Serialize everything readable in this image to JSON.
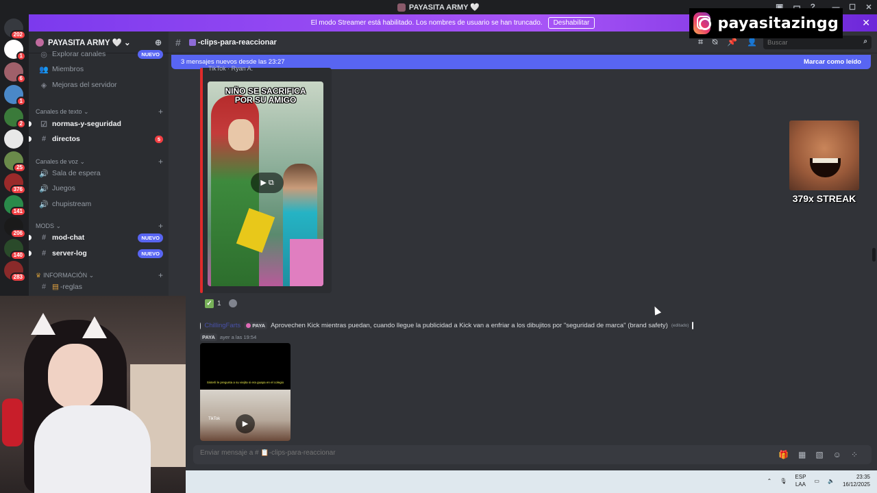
{
  "window": {
    "title": "PAYASITA ARMY 🤍",
    "controls": [
      "—",
      "☐",
      "✕"
    ]
  },
  "banner": {
    "text": "El modo Streamer está habilitado. Los nombres de usuario se han truncado.",
    "button": "Deshabilitar"
  },
  "servers": [
    {
      "badge": "202",
      "color": "#36393f"
    },
    {
      "badge": "1",
      "color": "#ffffff"
    },
    {
      "badge": "6",
      "color": "#a0606a"
    },
    {
      "badge": "1",
      "color": "#4a88c8"
    },
    {
      "badge": "2",
      "color": "#3a7a3a"
    },
    {
      "badge": "",
      "color": "#e8e8e8"
    },
    {
      "badge": "25",
      "color": "#6a8a4a"
    },
    {
      "badge": "376",
      "color": "#9a2a2a"
    },
    {
      "badge": "141",
      "color": "#2a8a4a"
    },
    {
      "badge": "206",
      "color": "#1a1a1a"
    },
    {
      "badge": "140",
      "color": "#2a4a2a"
    },
    {
      "badge": "283",
      "color": "#8a2a2a"
    }
  ],
  "server": {
    "name": "PAYASITA ARMY 🤍 ⌄"
  },
  "sidebar": {
    "top_items": [
      {
        "label": "Explorar canales",
        "badge": "NUEVO"
      },
      {
        "label": "Miembros"
      },
      {
        "label": "Mejoras del servidor"
      }
    ],
    "categories": {
      "text": "Canales de texto ⌄",
      "voice": "Canales de voz ⌄",
      "mods": "MODS ⌄",
      "info": "INFORMACIÓN ⌄"
    },
    "text_channels": [
      {
        "label": "normas-y-seguridad"
      },
      {
        "label": "directos",
        "count": "5"
      }
    ],
    "voice_channels": [
      {
        "label": "Sala de espera"
      },
      {
        "label": "Juegos"
      },
      {
        "label": "chupistream"
      }
    ],
    "mod_channels": [
      {
        "label": "mod-chat",
        "badge": "NUEVO"
      },
      {
        "label": "server-log",
        "badge": "NUEVO"
      }
    ],
    "info_channels": [
      {
        "label": "-reglas"
      }
    ]
  },
  "channel": {
    "name": "-clips-para-reaccionar",
    "search_placeholder": "Buscar"
  },
  "instagram": {
    "handle": "payasitazingg"
  },
  "new_messages": {
    "text": "3 mensajes nuevos desde las 23:27",
    "action": "Marcar como leído"
  },
  "embed1": {
    "author": "TikTok · Ryan A.",
    "caption_line1": "NIÑO SE SACRIFICA",
    "caption_line2": "POR SU AMIGO"
  },
  "reactions": [
    {
      "emoji": "✓",
      "count": "1"
    }
  ],
  "message2": {
    "username": "ChillingFarts",
    "tag": "PAYA",
    "text": "Aprovechen Kick mientras puedan, cuando llegue la publicidad a Kick van a enfriar a los dibujitos por \"seguridad de marca\" (brand safety)",
    "edited": "(editado)",
    "sub_tag": "PAYA",
    "timestamp": "ayer a las 19:54",
    "video_caption": "Sisterli le pregunta a su viejita si era guapa en el colegio",
    "video_source": "TikTok"
  },
  "streak": {
    "label": "379x STREAK"
  },
  "input": {
    "placeholder": "Enviar mensaje a # 📋-clips-para-reaccionar"
  },
  "taskbar": {
    "lang_top": "ESP",
    "lang_bottom": "LAA",
    "time": "23:35",
    "date": "16/12/2025"
  }
}
